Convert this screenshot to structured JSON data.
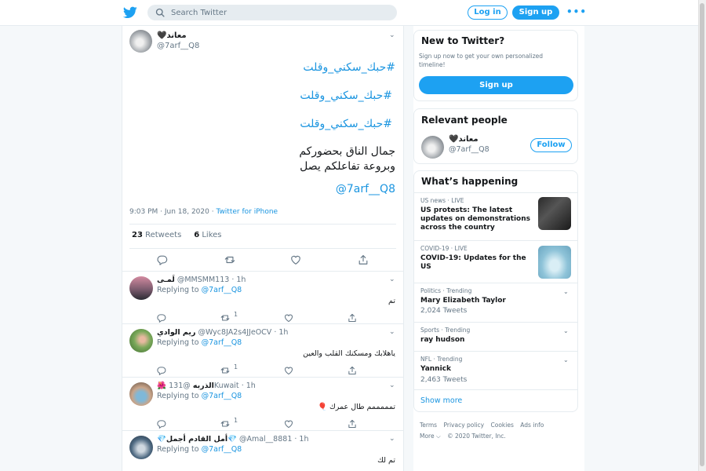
{
  "header": {
    "search_placeholder": "Search Twitter",
    "login_label": "Log in",
    "signup_label": "Sign up",
    "more_label": "•••"
  },
  "tweet": {
    "author_name": "🖤معاند",
    "author_handle": "@7arf__Q8",
    "hashtags": [
      "#حبك_سكني_وقلت",
      "#حبك_سكني_وقلت",
      "#حبك_سكني_وقلت"
    ],
    "text_lines": [
      "جمال الناق بحضوركم",
      "وبروعة تفاعلكم يصل"
    ],
    "mention": "@7arf__Q8",
    "time": "9:03 PM · Jun 18, 2020 · ",
    "source": "Twitter for iPhone",
    "retweets_count": "23",
    "retweets_label": "Retweets",
    "likes_count": "6",
    "likes_label": "Likes"
  },
  "replies": [
    {
      "name": "لَمـى",
      "handle": "@MMSMM113",
      "time": "· 1h",
      "replying_label": "Replying to",
      "replying_to": "@7arf__Q8",
      "text": "تم",
      "retweets": "1"
    },
    {
      "name": "ريم الوادي",
      "handle": "@Wyc8JA2s4JJeOCV",
      "time": "· 1h",
      "replying_label": "Replying to",
      "replying_to": "@7arf__Q8",
      "text": "ياهلابك ومسكنك القلب والعين",
      "retweets": "1"
    },
    {
      "name": "🌺 الذربه",
      "handle": "@131Kuwait",
      "time": "· 1h",
      "replying_label": "Replying to",
      "replying_to": "@7arf__Q8",
      "text": "تمممممم طال عمرك 🎈",
      "retweets": "1"
    },
    {
      "name": "💎أمل القادم أجمل💎",
      "handle": "@Amal__8881",
      "time": "· 1h",
      "replying_label": "Replying to",
      "replying_to": "@7arf__Q8",
      "text": "تم لك",
      "retweets": ""
    }
  ],
  "new_to_twitter": {
    "title": "New to Twitter?",
    "subtitle": "Sign up now to get your own personalized timeline!",
    "button": "Sign up"
  },
  "relevant_people": {
    "title": "Relevant people",
    "name": "🖤معاند",
    "handle": "@7arf__Q8",
    "follow_label": "Follow"
  },
  "whats_happening": {
    "title": "What’s happening",
    "trends": [
      {
        "meta": "US news · LIVE",
        "title": "US protests: The latest updates on demonstrations across the country",
        "count": ""
      },
      {
        "meta": "COVID-19 · LIVE",
        "title": "COVID-19: Updates for the US",
        "count": ""
      },
      {
        "meta": "Politics · Trending",
        "title": "Mary Elizabeth Taylor",
        "count": "2,024 Tweets"
      },
      {
        "meta": "Sports · Trending",
        "title": "ray hudson",
        "count": ""
      },
      {
        "meta": "NFL · Trending",
        "title": "Yannick",
        "count": "2,463 Tweets"
      }
    ],
    "show_more": "Show more"
  },
  "footer": {
    "links": [
      "Terms",
      "Privacy policy",
      "Cookies",
      "Ads info"
    ],
    "more": "More ⌵",
    "copyright": "© 2020 Twitter, Inc."
  },
  "colors": {
    "accent": "#1da1f2",
    "link": "#1b95e0",
    "muted": "#657786",
    "border": "#e6ecf0"
  }
}
